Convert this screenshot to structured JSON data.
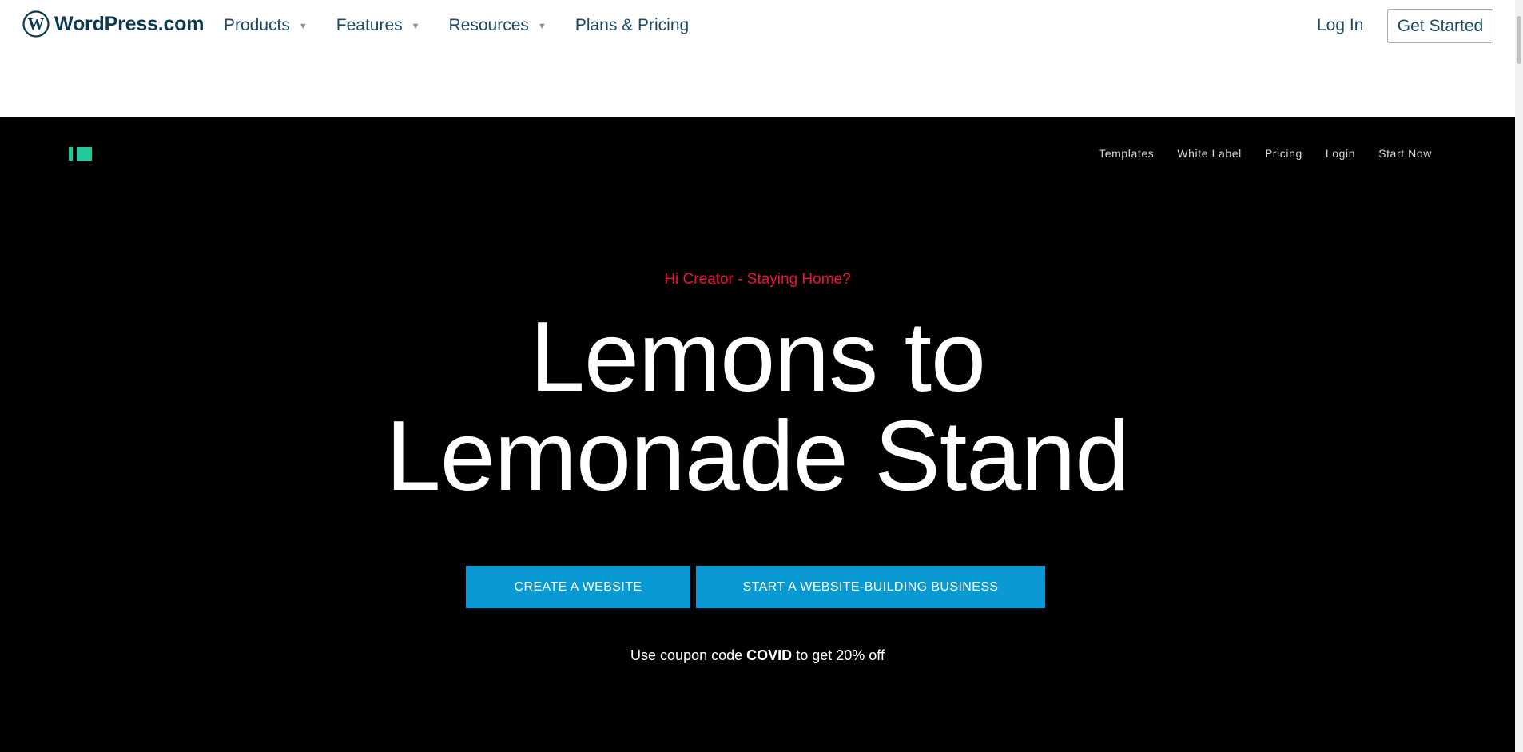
{
  "wp_header": {
    "brand": "WordPress.com",
    "nav": [
      {
        "label": "Products",
        "has_dropdown": true
      },
      {
        "label": "Features",
        "has_dropdown": true
      },
      {
        "label": "Resources",
        "has_dropdown": true
      },
      {
        "label": "Plans & Pricing",
        "has_dropdown": false
      }
    ],
    "login_label": "Log In",
    "cta_label": "Get Started"
  },
  "hero": {
    "logo_icon": "site-logo-icon",
    "nav": [
      "Templates",
      "White Label",
      "Pricing",
      "Login",
      "Start Now"
    ],
    "tagline": "Hi Creator - Staying Home?",
    "headline_line1": "Lemons to",
    "headline_line2": "Lemonade Stand",
    "buttons": {
      "create": "CREATE A WEBSITE",
      "business": "START A WEBSITE-BUILDING BUSINESS"
    },
    "coupon": {
      "prefix": "Use coupon code",
      "code": "COVID",
      "suffix": "to get 20% off"
    }
  },
  "colors": {
    "brand_text": "#0b3a52",
    "hero_bg": "#000000",
    "accent_green": "#21c89c",
    "tagline_red": "#f0123a",
    "cta_blue": "#0a9ad3"
  }
}
